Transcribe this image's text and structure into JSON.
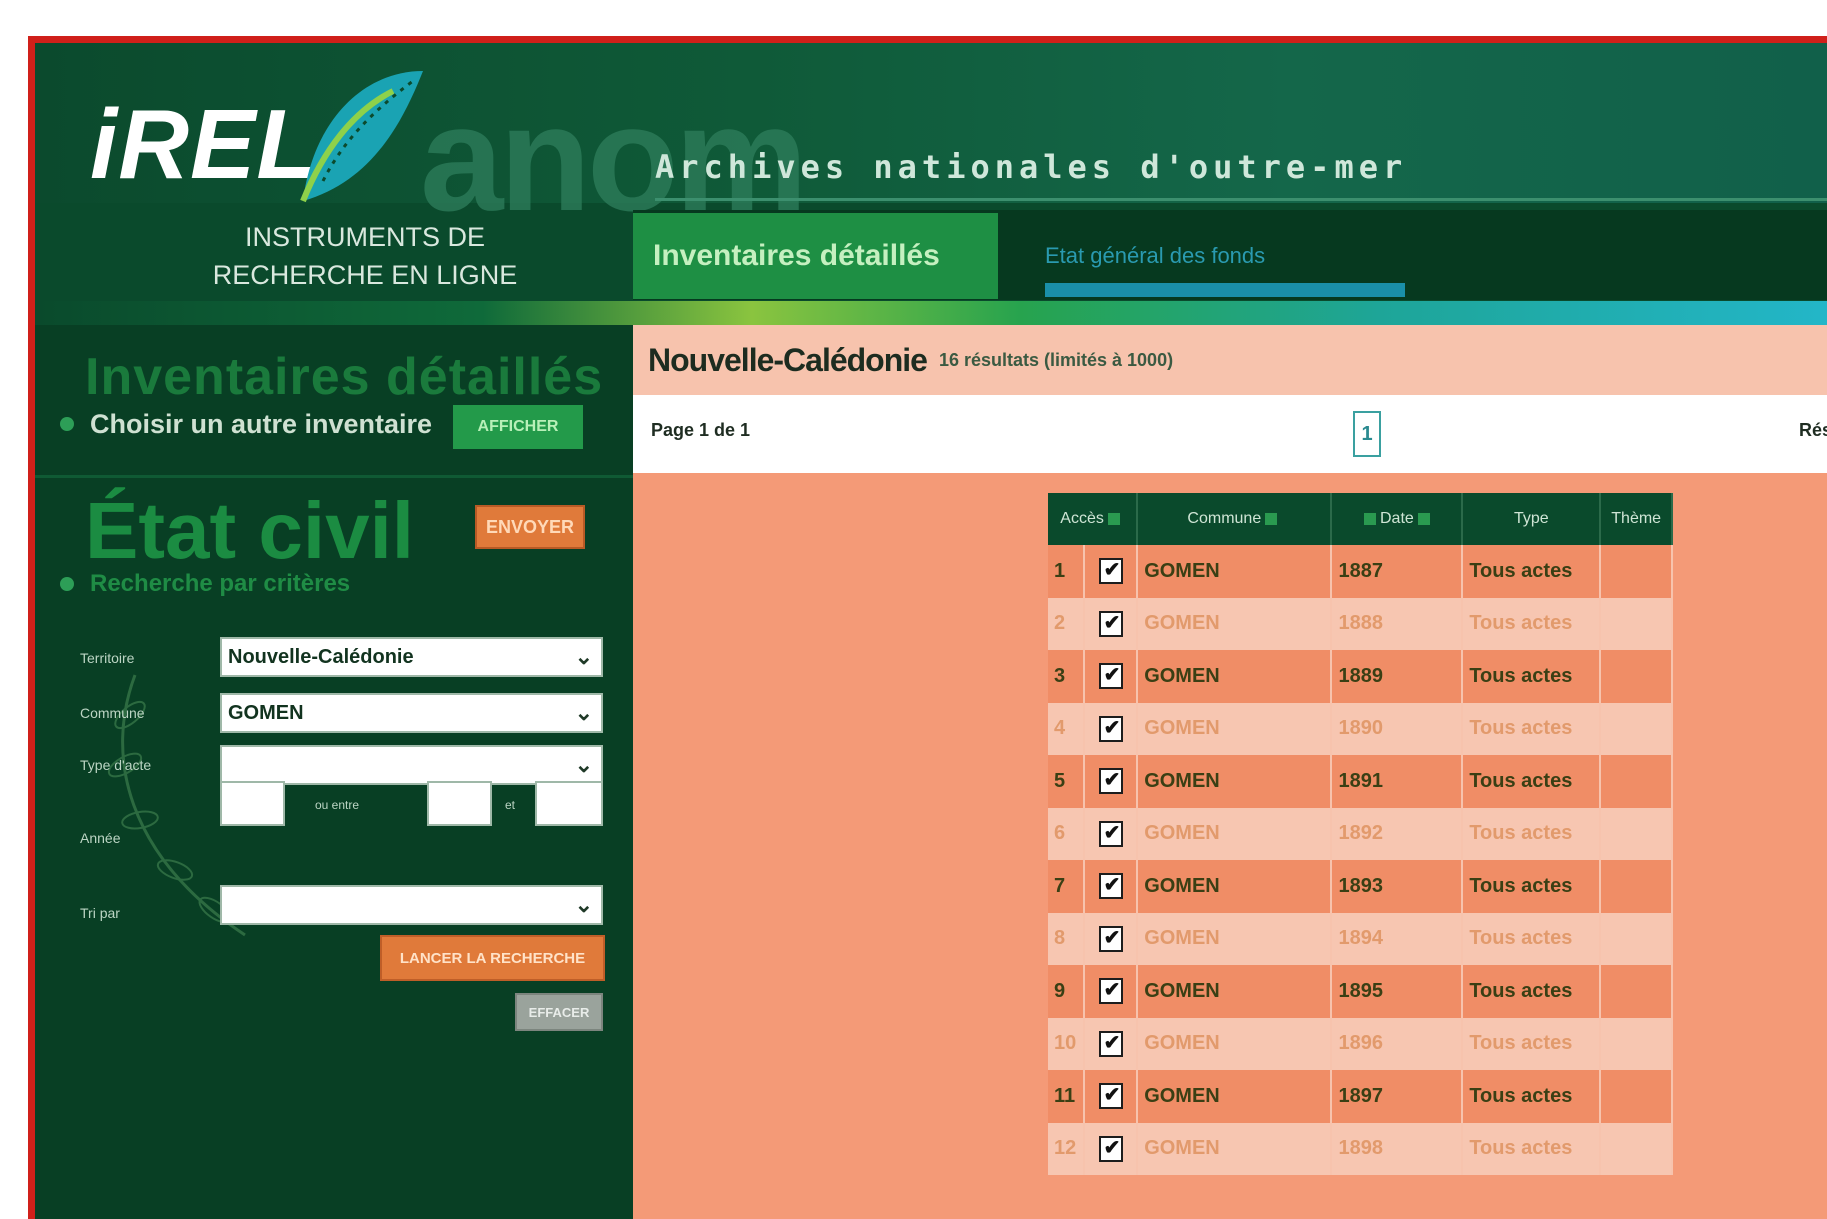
{
  "header": {
    "logo_text": "iREL",
    "brand": "anom",
    "subtitle": "Archives nationales d'outre-mer",
    "tagline_line1": "INSTRUMENTS DE",
    "tagline_line2": "RECHERCHE EN LIGNE"
  },
  "nav": {
    "tab_active": "Inventaires détaillés",
    "tab_second": "Etat général des fonds"
  },
  "sidebar": {
    "heading": "Inventaires détaillés",
    "choose_label": "Choisir un autre inventaire",
    "display_button": "AFFICHER",
    "section_title": "État civil",
    "orange_button": "ENVOYER",
    "search_link": "Recherche par critères",
    "form": {
      "territoire_label": "Territoire",
      "territoire_value": "Nouvelle-Calédonie",
      "commune_label": "Commune",
      "commune_value": "GOMEN",
      "type_label": "Type d'acte",
      "type_value": "",
      "annee_label": "Année",
      "annee_between": "ou entre",
      "annee_and": "et",
      "tri_label": "Tri par",
      "tri_value": ""
    },
    "launch_button": "LANCER LA RECHERCHE",
    "reset_button": "EFFACER"
  },
  "main": {
    "title": "Nouvelle-Calédonie",
    "results_summary": "16 résultats (limités à 1000)",
    "pager_text": "Page 1 de 1",
    "pager_current": "1",
    "pager_right": "Résultats"
  },
  "table": {
    "headers": [
      "Accès",
      "Commune",
      "Date",
      "Type",
      "Thème"
    ],
    "rows": [
      {
        "n": "1",
        "commune": "GOMEN",
        "date": "1887",
        "type": "Tous actes"
      },
      {
        "n": "2",
        "commune": "GOMEN",
        "date": "1888",
        "type": "Tous actes"
      },
      {
        "n": "3",
        "commune": "GOMEN",
        "date": "1889",
        "type": "Tous actes"
      },
      {
        "n": "4",
        "commune": "GOMEN",
        "date": "1890",
        "type": "Tous actes"
      },
      {
        "n": "5",
        "commune": "GOMEN",
        "date": "1891",
        "type": "Tous actes"
      },
      {
        "n": "6",
        "commune": "GOMEN",
        "date": "1892",
        "type": "Tous actes"
      },
      {
        "n": "7",
        "commune": "GOMEN",
        "date": "1893",
        "type": "Tous actes"
      },
      {
        "n": "8",
        "commune": "GOMEN",
        "date": "1894",
        "type": "Tous actes"
      },
      {
        "n": "9",
        "commune": "GOMEN",
        "date": "1895",
        "type": "Tous actes"
      },
      {
        "n": "10",
        "commune": "GOMEN",
        "date": "1896",
        "type": "Tous actes"
      },
      {
        "n": "11",
        "commune": "GOMEN",
        "date": "1897",
        "type": "Tous actes"
      },
      {
        "n": "12",
        "commune": "GOMEN",
        "date": "1898",
        "type": "Tous actes"
      }
    ]
  },
  "colors": {
    "frame_border": "#d0201a",
    "dark_green": "#0a4a2c",
    "active_tab": "#1e8f44",
    "salmon": "#f49a77",
    "orange_button": "#e07a3a"
  }
}
